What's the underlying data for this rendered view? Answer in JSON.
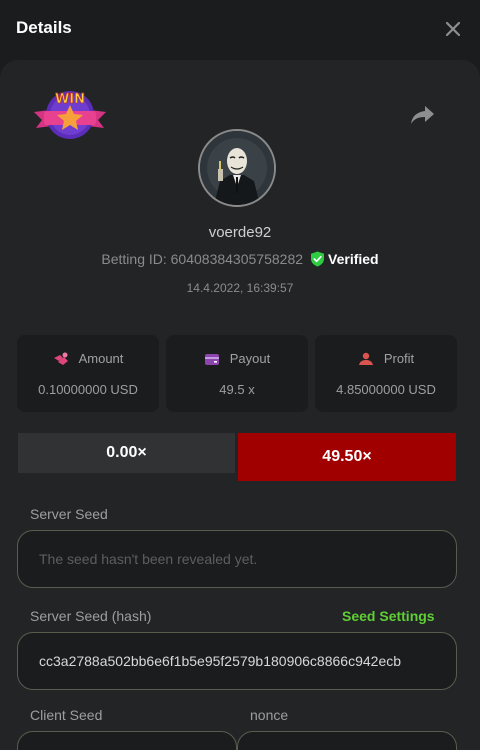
{
  "header": {
    "title": "Details"
  },
  "bet": {
    "username": "voerde92",
    "betting_id": "Betting ID: 60408384305758282",
    "verified_label": "Verified",
    "timestamp": "14.4.2022, 16:39:57"
  },
  "badge": {
    "text": "WIN"
  },
  "cards": [
    {
      "label": "Amount",
      "value": "0.10000000 USD",
      "icon": "amount-icon"
    },
    {
      "label": "Payout",
      "value": "49.5 x",
      "icon": "wallet-icon"
    },
    {
      "label": "Profit",
      "value": "4.85000000 USD",
      "icon": "profit-icon"
    }
  ],
  "multipliers": {
    "left": "0.00×",
    "right": "49.50×"
  },
  "seeds": {
    "server_label": "Server Seed",
    "server_placeholder": "The seed hasn't been revealed yet.",
    "hash_label": "Server Seed (hash)",
    "hash_value": "cc3a2788a502bb6e6f1b5e95f2579b180906c8866c942ecb",
    "settings_link": "Seed Settings",
    "client_label": "Client Seed",
    "nonce_label": "nonce"
  },
  "colors": {
    "accent_green": "#5fcf35",
    "multiplier_red": "#a00000",
    "verified_green": "#2ecc40",
    "icon_pink": "#e0457b",
    "icon_purple": "#8e44ad",
    "icon_red": "#d9534f"
  }
}
